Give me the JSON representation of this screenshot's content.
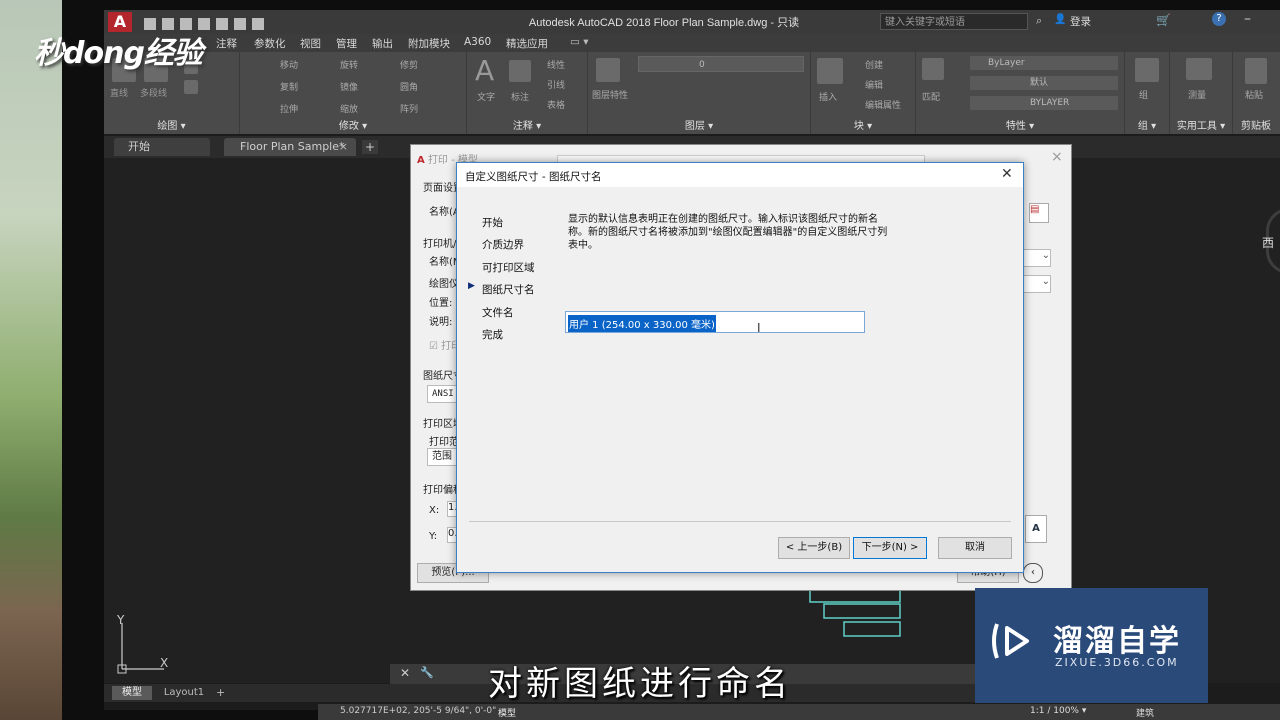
{
  "logo": {
    "text": "秒dong经验"
  },
  "app": {
    "title": "Autodesk AutoCAD 2018    Floor Plan Sample.dwg - 只读",
    "search_placeholder": "键入关键字或短语",
    "login": "登录"
  },
  "menu": [
    "注释",
    "参数化",
    "视图",
    "管理",
    "输出",
    "附加模块",
    "A360",
    "精选应用"
  ],
  "ribbon": {
    "panels": [
      "绘图 ▾",
      "修改 ▾",
      "注释 ▾",
      "图层 ▾",
      "块 ▾",
      "特性 ▾",
      "组 ▾",
      "实用工具 ▾",
      "剪贴板"
    ],
    "small": [
      "直线",
      "多段线",
      "移动",
      "旋转",
      "修剪",
      "复制",
      "镜像",
      "圆角",
      "拉伸",
      "缩放",
      "阵列",
      "文字",
      "标注",
      "线性",
      "引线",
      "表格",
      "图层特性",
      "插入",
      "创建",
      "编辑",
      "编辑属性",
      "匹配",
      "组",
      "测量",
      "粘贴"
    ],
    "bylayer": "ByLayer",
    "default": "默认",
    "bylayer2": "BYLAYER",
    "layer_value": "0"
  },
  "doc_tabs": [
    "开始",
    "Floor Plan Sample*"
  ],
  "plot_dialog": {
    "title": "打印 - 模型",
    "labels": [
      "页面设置",
      "名称(A",
      "打印机/",
      "名称(M",
      "绘图仪",
      "位置:",
      "说明:",
      "打印",
      "图纸尺寸",
      "ANSI",
      "打印区域",
      "打印范",
      "范围",
      "打印偏移",
      "X:",
      "Y:",
      "1.",
      "0."
    ],
    "preview_button": "预览(P)...",
    "help_button": "帮助(H)"
  },
  "wizard": {
    "title": "自定义图纸尺寸 - 图纸尺寸名",
    "steps": [
      "开始",
      "介质边界",
      "可打印区域",
      "图纸尺寸名",
      "文件名",
      "完成"
    ],
    "current_step_index": 3,
    "description": "显示的默认信息表明正在创建的图纸尺寸。输入标识该图纸尺寸的新名称。新的图纸尺寸名将被添加到\"绘图仪配置编辑器\"的自定义图纸尺寸列表中。",
    "name_value": "用户 1 (254.00 x 330.00 毫米)",
    "back_button": "< 上一步(B)",
    "next_button": "下一步(N) >",
    "cancel_button": "取消"
  },
  "compass": "西",
  "axis": {
    "x": "X",
    "y": "Y"
  },
  "layout_tabs": [
    "模型",
    "Layout1"
  ],
  "status": {
    "coords": "5.027717E+02, 205'-5 9/64\", 0'-0\"",
    "model": "模型",
    "scale": "1:1 / 100% ▾",
    "workspace": "建筑"
  },
  "subtitle": "对新图纸进行命名",
  "watermark": {
    "title": "溜溜自学",
    "url": "ZIXUE.3D66.COM"
  }
}
